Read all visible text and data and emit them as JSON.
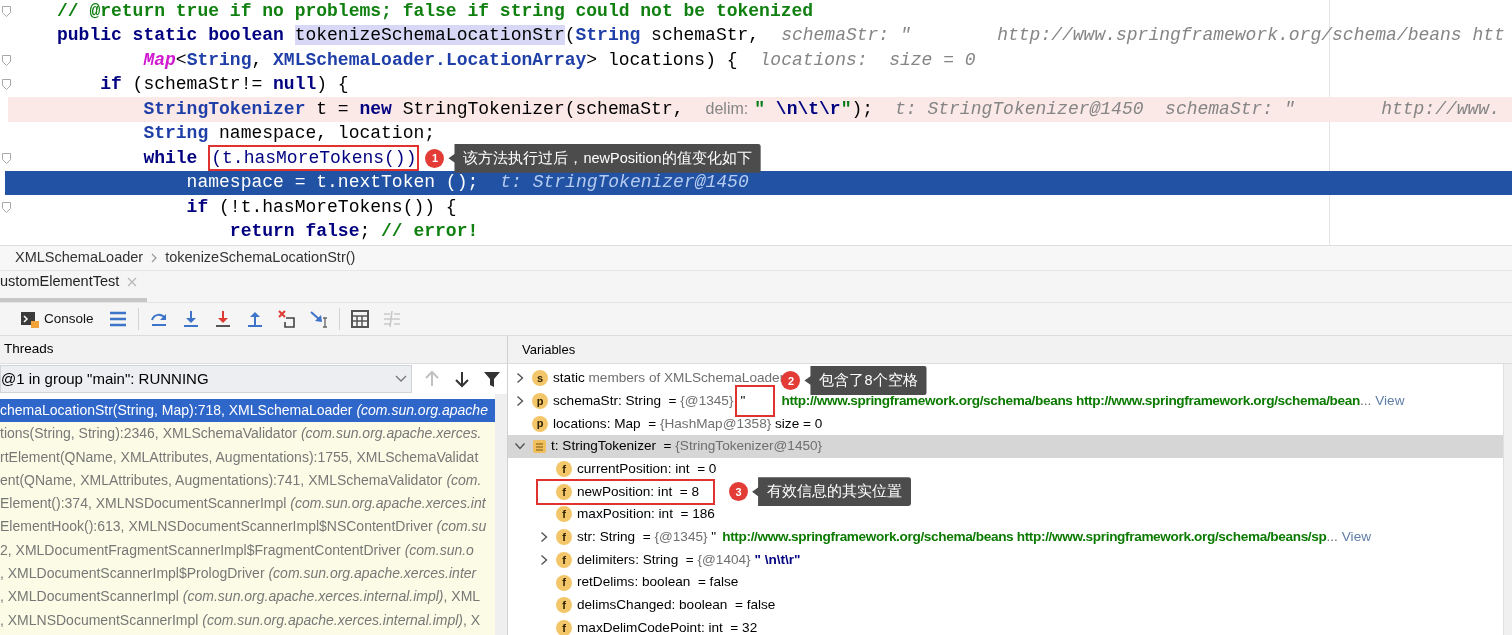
{
  "editor": {
    "lines": [
      {
        "kind": "normal",
        "fold_marker": true,
        "tokens": [
          {
            "kind": "comment",
            "text": "// @return true if no problems; false if string could not be tokenized"
          }
        ]
      },
      {
        "kind": "normal",
        "fold_marker": false,
        "tokens": [
          {
            "kind": "kw",
            "text": "public static boolean "
          },
          {
            "kind": "decl",
            "text": "tokenizeSchemaLocationStr"
          },
          {
            "kind": "plain",
            "text": "("
          },
          {
            "kind": "type",
            "text": "String"
          },
          {
            "kind": "plain",
            "text": " schemaStr,"
          },
          {
            "kind": "inlay",
            "text": "schemaStr: \"        http://www.springframework.org/schema/beans htt"
          }
        ]
      },
      {
        "kind": "normal",
        "fold_marker": true,
        "tokens": [
          {
            "kind": "magenta",
            "text": "        Map"
          },
          {
            "kind": "plain",
            "text": "<"
          },
          {
            "kind": "type",
            "text": "String"
          },
          {
            "kind": "plain",
            "text": ", "
          },
          {
            "kind": "type",
            "text": "XMLSchemaLoader.LocationArray"
          },
          {
            "kind": "plain",
            "text": "> locations) {"
          },
          {
            "kind": "inlay",
            "text": "locations:  size = 0"
          }
        ]
      },
      {
        "kind": "normal",
        "fold_marker": true,
        "tokens": [
          {
            "kind": "kw",
            "text": "    if"
          },
          {
            "kind": "plain",
            "text": " (schemaStr!= "
          },
          {
            "kind": "kw",
            "text": "null"
          },
          {
            "kind": "plain",
            "text": ") {"
          }
        ]
      },
      {
        "kind": "breakpoint",
        "fold_marker": false,
        "tokens": [
          {
            "kind": "type",
            "text": "        StringTokenizer"
          },
          {
            "kind": "plain",
            "text": " t = "
          },
          {
            "kind": "kw",
            "text": "new"
          },
          {
            "kind": "plain",
            "text": " StringTokenizer(schemaStr,"
          },
          {
            "kind": "hint",
            "text": "delim:"
          },
          {
            "kind": "str",
            "text": "\" "
          },
          {
            "kind": "esc",
            "text": "\\n\\t\\r"
          },
          {
            "kind": "str",
            "text": "\""
          },
          {
            "kind": "plain",
            "text": ");"
          },
          {
            "kind": "inlay",
            "text": "t: StringTokenizer@1450  schemaStr: \"        http://www."
          }
        ]
      },
      {
        "kind": "normal",
        "fold_marker": false,
        "tokens": [
          {
            "kind": "type",
            "text": "        String"
          },
          {
            "kind": "plain",
            "text": " namespace, location;"
          }
        ]
      },
      {
        "kind": "normal",
        "fold_marker": true,
        "tokens": [
          {
            "kind": "kw",
            "text": "        while "
          },
          {
            "kind": "boxed",
            "text": "(t.hasMoreTokens())"
          }
        ],
        "callout": {
          "number": "1",
          "text": "该方法执行过后，newPosition的值变化如下"
        }
      },
      {
        "kind": "execution",
        "fold_marker": false,
        "tokens": [
          {
            "kind": "plain",
            "text": "            namespace = t.nextToken ();"
          },
          {
            "kind": "inlay",
            "text": "t: StringTokenizer@1450"
          }
        ]
      },
      {
        "kind": "normal",
        "fold_marker": true,
        "tokens": [
          {
            "kind": "kw",
            "text": "            if"
          },
          {
            "kind": "plain",
            "text": " (!t.hasMoreTokens()) {"
          }
        ]
      },
      {
        "kind": "normal",
        "fold_marker": false,
        "tokens": [
          {
            "kind": "kw",
            "text": "                return false"
          },
          {
            "kind": "plain",
            "text": "; "
          },
          {
            "kind": "comment",
            "text": "// error!"
          }
        ]
      }
    ]
  },
  "breadcrumbs": [
    "XMLSchemaLoader",
    "tokenizeSchemaLocationStr()"
  ],
  "run_tab": {
    "label": "ustomElementTest"
  },
  "toolbar": [
    {
      "kind": "console",
      "label": "Console",
      "disabled": false
    },
    {
      "kind": "layout",
      "disabled": false
    },
    {
      "kind": "step_over",
      "disabled": false
    },
    {
      "kind": "step_into",
      "disabled": false
    },
    {
      "kind": "force_step_into",
      "disabled": false
    },
    {
      "kind": "step_out",
      "disabled": false
    },
    {
      "kind": "drop_frame",
      "disabled": false
    },
    {
      "kind": "run_to_cursor",
      "disabled": false
    },
    {
      "kind": "evaluate",
      "disabled": false
    },
    {
      "kind": "trace",
      "disabled": true
    }
  ],
  "threads": {
    "title": "Threads",
    "selector": {
      "value": "@1 in group \"main\": RUNNING"
    },
    "buttons": [
      {
        "kind": "up",
        "disabled": true
      },
      {
        "kind": "down",
        "disabled": false
      },
      {
        "kind": "filter",
        "disabled": false
      }
    ],
    "frames": [
      {
        "selected": true,
        "segments": [
          {
            "kind": "call",
            "text": "chemaLocationStr(String, Map):718, XMLSchemaLoader "
          },
          {
            "kind": "package",
            "text": "(com.sun.org.apache"
          }
        ]
      },
      {
        "selected": false,
        "segments": [
          {
            "kind": "call",
            "text": "tions(String, String):2346, XMLSchemaValidator "
          },
          {
            "kind": "package",
            "text": "(com.sun.org.apache.xerces."
          }
        ]
      },
      {
        "selected": false,
        "segments": [
          {
            "kind": "call",
            "text": "rtElement(QName, XMLAttributes, Augmentations):1755, XMLSchemaValidat"
          }
        ]
      },
      {
        "selected": false,
        "segments": [
          {
            "kind": "call",
            "text": "ent(QName, XMLAttributes, Augmentations):741, XMLSchemaValidator "
          },
          {
            "kind": "package",
            "text": "(com."
          }
        ]
      },
      {
        "selected": false,
        "segments": [
          {
            "kind": "call",
            "text": "Element():374, XMLNSDocumentScannerImpl "
          },
          {
            "kind": "package",
            "text": "(com.sun.org.apache.xerces.int"
          }
        ]
      },
      {
        "selected": false,
        "segments": [
          {
            "kind": "call",
            "text": "ElementHook():613, XMLNSDocumentScannerImpl$NSContentDriver "
          },
          {
            "kind": "package",
            "text": "(com.su"
          }
        ]
      },
      {
        "selected": false,
        "segments": [
          {
            "kind": "call",
            "text": "2, XMLDocumentFragmentScannerImpl$FragmentContentDriver "
          },
          {
            "kind": "package",
            "text": "(com.sun.o"
          }
        ]
      },
      {
        "selected": false,
        "segments": [
          {
            "kind": "call",
            "text": ", XMLDocumentScannerImpl$PrologDriver "
          },
          {
            "kind": "package",
            "text": "(com.sun.org.apache.xerces.inter"
          }
        ]
      },
      {
        "selected": false,
        "segments": [
          {
            "kind": "call",
            "text": ", XMLDocumentScannerImpl "
          },
          {
            "kind": "package",
            "text": "(com.sun.org.apache.xerces.internal.impl)"
          },
          {
            "kind": "call",
            "text": ", XML"
          }
        ]
      },
      {
        "selected": false,
        "segments": [
          {
            "kind": "call",
            "text": ", XMLNSDocumentScannerImpl "
          },
          {
            "kind": "package",
            "text": "(com.sun.org.apache.xerces.internal.impl)"
          },
          {
            "kind": "call",
            "text": ", X"
          }
        ]
      }
    ]
  },
  "variables": {
    "title": "Variables",
    "rows": [
      {
        "kind": "group",
        "expanded": false,
        "badge": "s",
        "selected": false,
        "segments": [
          {
            "kind": "name",
            "text": "static"
          },
          {
            "kind": "ref",
            "text": " members of XMLSchemaLoader"
          }
        ]
      },
      {
        "kind": "group",
        "expanded": false,
        "badge": "p",
        "selected": false,
        "segments": [
          {
            "kind": "name",
            "text": "schemaStr"
          },
          {
            "kind": "value",
            "text": ": String  = "
          },
          {
            "kind": "ref",
            "text": "{@1345}"
          },
          {
            "kind": "boxed",
            "text": "\""
          },
          {
            "kind": "string",
            "text": "http://www.springframework.org/schema/beans http://www.springframework.org/schema/bean"
          },
          {
            "kind": "ref",
            "text": "..."
          },
          {
            "kind": "link",
            "text": "View"
          }
        ],
        "callout": {
          "kind": "segment",
          "number": "2",
          "text": "包含了8个空格"
        }
      },
      {
        "kind": "leaf",
        "badge": "p",
        "selected": false,
        "segments": [
          {
            "kind": "name",
            "text": "locations"
          },
          {
            "kind": "value",
            "text": ": Map  = "
          },
          {
            "kind": "ref",
            "text": "{HashMap@1358}"
          },
          {
            "kind": "value",
            "text": " size = 0"
          }
        ]
      },
      {
        "kind": "group",
        "expanded": true,
        "selected": true,
        "segments": [
          {
            "kind": "value",
            "text": "t: StringTokenizer  = "
          },
          {
            "kind": "ref",
            "text": "{StringTokenizer@1450}"
          }
        ],
        "children": [
          {
            "kind": "leaf",
            "badge": "f",
            "selected": false,
            "segments": [
              {
                "kind": "name",
                "text": "currentPosition"
              },
              {
                "kind": "value",
                "text": ": int  = 0"
              }
            ]
          },
          {
            "kind": "leaf",
            "badge": "f",
            "selected": false,
            "segments": [
              {
                "kind": "name",
                "text": "newPosition"
              },
              {
                "kind": "value",
                "text": ": int  = 8"
              }
            ],
            "callout": {
              "kind": "row",
              "number": "3",
              "text": "有效信息的其实位置"
            }
          },
          {
            "kind": "leaf",
            "badge": "f",
            "selected": false,
            "segments": [
              {
                "kind": "name",
                "text": "maxPosition"
              },
              {
                "kind": "value",
                "text": ": int  = 186"
              }
            ]
          },
          {
            "kind": "group",
            "expanded": false,
            "badge": "f",
            "selected": false,
            "segments": [
              {
                "kind": "name",
                "text": "str"
              },
              {
                "kind": "value",
                "text": ": String  = "
              },
              {
                "kind": "ref",
                "text": "{@1345}"
              },
              {
                "kind": "value",
                "text": " \""
              },
              {
                "kind": "string",
                "text": "http://www.springframework.org/schema/beans http://www.springframework.org/schema/beans/sp"
              },
              {
                "kind": "ref",
                "text": "..."
              },
              {
                "kind": "link",
                "text": "View"
              }
            ]
          },
          {
            "kind": "group",
            "expanded": false,
            "badge": "f",
            "selected": false,
            "segments": [
              {
                "kind": "name",
                "text": "delimiters"
              },
              {
                "kind": "value",
                "text": ": String  = "
              },
              {
                "kind": "ref",
                "text": "{@1404}"
              },
              {
                "kind": "esc",
                "text": " \" \\n\\t\\r\""
              }
            ]
          },
          {
            "kind": "leaf",
            "badge": "f",
            "selected": false,
            "segments": [
              {
                "kind": "name",
                "text": "retDelims"
              },
              {
                "kind": "value",
                "text": ": boolean  = false"
              }
            ]
          },
          {
            "kind": "leaf",
            "badge": "f",
            "selected": false,
            "segments": [
              {
                "kind": "name",
                "text": "delimsChanged"
              },
              {
                "kind": "value",
                "text": ": boolean  = false"
              }
            ]
          },
          {
            "kind": "leaf",
            "badge": "f",
            "selected": false,
            "segments": [
              {
                "kind": "name",
                "text": "maxDelimCodePoint"
              },
              {
                "kind": "value",
                "text": ": int  = 32"
              }
            ]
          }
        ]
      }
    ]
  }
}
